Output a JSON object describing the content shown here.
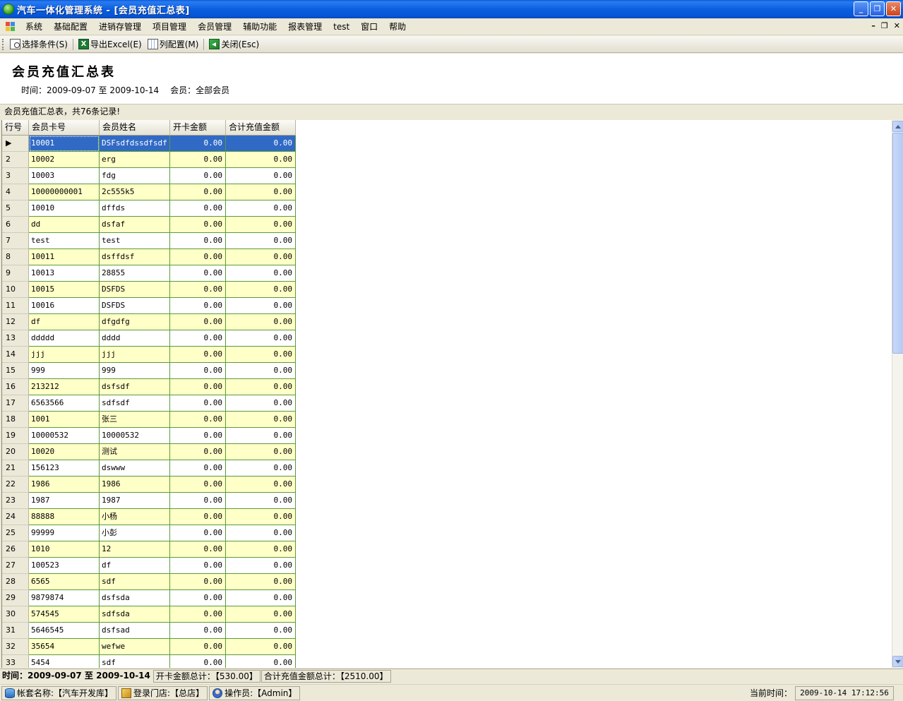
{
  "window": {
    "title": "汽车一体化管理系统 - [会员充值汇总表]",
    "minimize_glyph": "_",
    "restore_glyph": "❐",
    "close_glyph": "✕"
  },
  "menu": {
    "items": [
      "系统",
      "基础配置",
      "进销存管理",
      "项目管理",
      "会员管理",
      "辅助功能",
      "报表管理",
      "test",
      "窗口",
      "帮助"
    ],
    "mdi_minimize": "–",
    "mdi_restore": "❐",
    "mdi_close": "✕"
  },
  "toolbar": {
    "select_condition": "选择条件(S)",
    "export_excel": "导出Excel(E)",
    "column_config": "列配置(M)",
    "close": "关闭(Esc)",
    "excel_glyph": "X"
  },
  "report": {
    "title": "会员充值汇总表",
    "time_range": "时间：2009-09-07 至 2009-10-14",
    "member_filter": "会员：全部会员"
  },
  "caption": "会员充值汇总表，共76条记录!",
  "grid": {
    "columns": [
      "行号",
      "会员卡号",
      "会员姓名",
      "开卡金额",
      "合计充值金额"
    ],
    "selected_marker": "▶",
    "rows": [
      [
        "1",
        "10001",
        "DSFsdfdssdfsdf",
        "0.00",
        "0.00"
      ],
      [
        "2",
        "10002",
        "erg",
        "0.00",
        "0.00"
      ],
      [
        "3",
        "10003",
        "fdg",
        "0.00",
        "0.00"
      ],
      [
        "4",
        "10000000001",
        "2c555k5",
        "0.00",
        "0.00"
      ],
      [
        "5",
        "10010",
        "dffds",
        "0.00",
        "0.00"
      ],
      [
        "6",
        "dd",
        "dsfaf",
        "0.00",
        "0.00"
      ],
      [
        "7",
        "test",
        "test",
        "0.00",
        "0.00"
      ],
      [
        "8",
        "10011",
        "dsffdsf",
        "0.00",
        "0.00"
      ],
      [
        "9",
        "10013",
        "28855",
        "0.00",
        "0.00"
      ],
      [
        "10",
        "10015",
        "DSFDS",
        "0.00",
        "0.00"
      ],
      [
        "11",
        "10016",
        "DSFDS",
        "0.00",
        "0.00"
      ],
      [
        "12",
        "df",
        "dfgdfg",
        "0.00",
        "0.00"
      ],
      [
        "13",
        "ddddd",
        "dddd",
        "0.00",
        "0.00"
      ],
      [
        "14",
        "jjj",
        "jjj",
        "0.00",
        "0.00"
      ],
      [
        "15",
        "999",
        "999",
        "0.00",
        "0.00"
      ],
      [
        "16",
        "213212",
        "dsfsdf",
        "0.00",
        "0.00"
      ],
      [
        "17",
        "6563566",
        "sdfsdf",
        "0.00",
        "0.00"
      ],
      [
        "18",
        "1001",
        "张三",
        "0.00",
        "0.00"
      ],
      [
        "19",
        "10000532",
        "10000532",
        "0.00",
        "0.00"
      ],
      [
        "20",
        "10020",
        "测试",
        "0.00",
        "0.00"
      ],
      [
        "21",
        "156123",
        "dswww",
        "0.00",
        "0.00"
      ],
      [
        "22",
        "1986",
        "1986",
        "0.00",
        "0.00"
      ],
      [
        "23",
        "1987",
        "1987",
        "0.00",
        "0.00"
      ],
      [
        "24",
        "88888",
        "小杨",
        "0.00",
        "0.00"
      ],
      [
        "25",
        "99999",
        "小彭",
        "0.00",
        "0.00"
      ],
      [
        "26",
        "1010",
        "12",
        "0.00",
        "0.00"
      ],
      [
        "27",
        "100523",
        "df",
        "0.00",
        "0.00"
      ],
      [
        "28",
        "6565",
        "sdf",
        "0.00",
        "0.00"
      ],
      [
        "29",
        "9879874",
        "dsfsda",
        "0.00",
        "0.00"
      ],
      [
        "30",
        "574545",
        "sdfsda",
        "0.00",
        "0.00"
      ],
      [
        "31",
        "5646545",
        "dsfsad",
        "0.00",
        "0.00"
      ],
      [
        "32",
        "35654",
        "wefwe",
        "0.00",
        "0.00"
      ],
      [
        "33",
        "5454",
        "sdf",
        "0.00",
        "0.00"
      ]
    ]
  },
  "footer": {
    "time_range": "时间：2009-09-07 至 2009-10-14",
    "open_total": "开卡金额总计：【530.00】",
    "recharge_total": "合计充值金额总计：【2510.00】"
  },
  "status": {
    "account": "帐套名称:【汽车开发库】",
    "store": "登录门店:【总店】",
    "operator": "操作员:【Admin】",
    "time_label": "当前时间：",
    "time_value": "2009-10-14 17:12:56"
  },
  "colors": {
    "title_bar": "#0a5fe0",
    "row_alt": "#ffffc8",
    "selection": "#316ac5",
    "grid_line": "#5b9a3a"
  }
}
